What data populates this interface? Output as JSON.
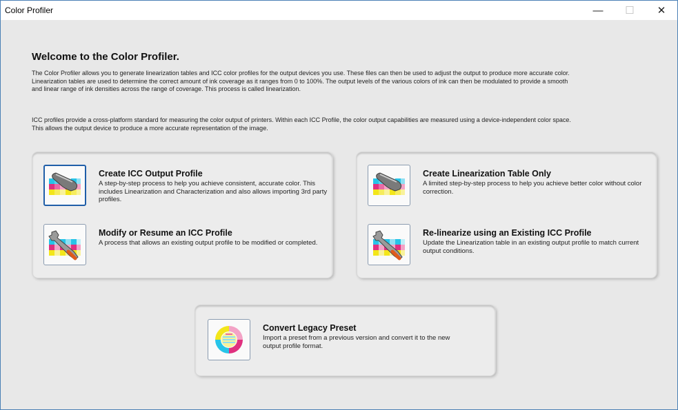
{
  "window": {
    "title": "Color Profiler",
    "minimize": "—",
    "maximize": "☐",
    "close": "✕"
  },
  "intro": {
    "heading": "Welcome to the Color Profiler.",
    "paragraph1": "The Color Profiler allows you to generate linearization tables and ICC color profiles for the output devices you use. These files can then be used to adjust the output to produce more accurate color. Linearization tables are used to determine the correct amount of ink coverage as it ranges from 0 to 100%. The output levels of the various colors of ink can then be modulated to provide a smooth and linear range of ink densities across the range of coverage. This process is called linearization.",
    "paragraph2": "ICC profiles provide a cross-platform standard for measuring the color output of printers. Within each ICC Profile, the color output capabilities are measured using a device-independent color space. This allows the output device to produce a more accurate representation of the image."
  },
  "options": {
    "create_icc": {
      "title": "Create ICC Output Profile",
      "desc": "A step-by-step process to help you achieve consistent, accurate color. This includes Linearization and Characterization and also allows importing 3rd party profiles."
    },
    "modify_icc": {
      "title": "Modify or Resume an ICC Profile",
      "desc": "A process that allows an existing output profile to be modified or completed."
    },
    "create_lin": {
      "title": "Create Linearization Table Only",
      "desc": "A limited step-by-step process to help you achieve better color without color correction."
    },
    "relinearize": {
      "title": "Re-linearize using an Existing ICC Profile",
      "desc": "Update the Linearization table in an existing output profile to match current output conditions."
    },
    "convert_legacy": {
      "title": "Convert Legacy Preset",
      "desc": "Import a preset from a previous version and convert it to the new output profile format."
    }
  },
  "colors": {
    "accent": "#1f5ea8",
    "cyan": "#27c4e8",
    "magenta": "#e0307f",
    "yellow": "#f3e61a"
  }
}
